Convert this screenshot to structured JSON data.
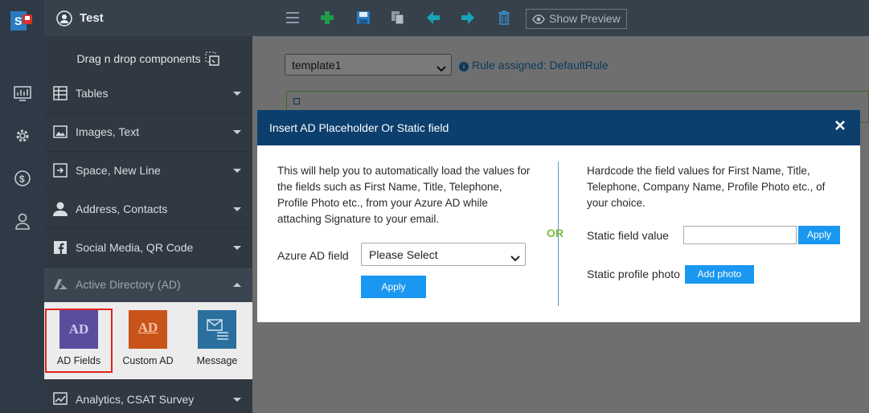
{
  "app": {
    "title": "Test"
  },
  "sidebar": {
    "drag_drop": "Drag n drop components",
    "items": [
      {
        "label": "Tables",
        "icon": "table-icon"
      },
      {
        "label": "Images, Text",
        "icon": "image-icon"
      },
      {
        "label": "Space, New Line",
        "icon": "new-line-icon"
      },
      {
        "label": "Address, Contacts",
        "icon": "contact-icon"
      },
      {
        "label": "Social Media, QR Code",
        "icon": "facebook-icon"
      },
      {
        "label": "Active Directory (AD)",
        "icon": "azure-icon",
        "expanded": true
      },
      {
        "label": "Analytics, CSAT Survey",
        "icon": "analytics-icon"
      }
    ],
    "ad_components": [
      {
        "label": "AD Fields",
        "icon_text": "AD",
        "color": "#5b4d9e",
        "selected": true
      },
      {
        "label": "Custom AD",
        "icon_text": "AD",
        "color": "#c8541a"
      },
      {
        "label": "Message",
        "icon": "message-icon",
        "color": "#2a6f9e"
      }
    ]
  },
  "toolbar": {
    "show_preview": "Show Preview"
  },
  "template": {
    "selected": "template1",
    "rule_info": "Rule assigned: DefaultRule"
  },
  "modal": {
    "title": "Insert AD Placeholder Or Static field",
    "left_description": "This will help you to automatically load the values for the fields such as First Name, Title, Telephone, Profile Photo etc., from your Azure AD while attaching Signature to your email.",
    "azure_label": "Azure AD field",
    "azure_select": "Please Select",
    "apply_left": "Apply",
    "or": "OR",
    "right_description": "Hardcode the field values for First Name, Title, Telephone, Company Name, Profile Photo etc., of your choice.",
    "static_label": "Static field value",
    "static_value": "",
    "apply_right": "Apply",
    "photo_label": "Static profile photo",
    "add_photo": "Add photo"
  },
  "colors": {
    "sidebar_bg": "#303841",
    "modal_header": "#0c3f6e",
    "button_blue": "#1a97f0",
    "or_green": "#7cbf3c",
    "selected_border": "#e2231a"
  }
}
